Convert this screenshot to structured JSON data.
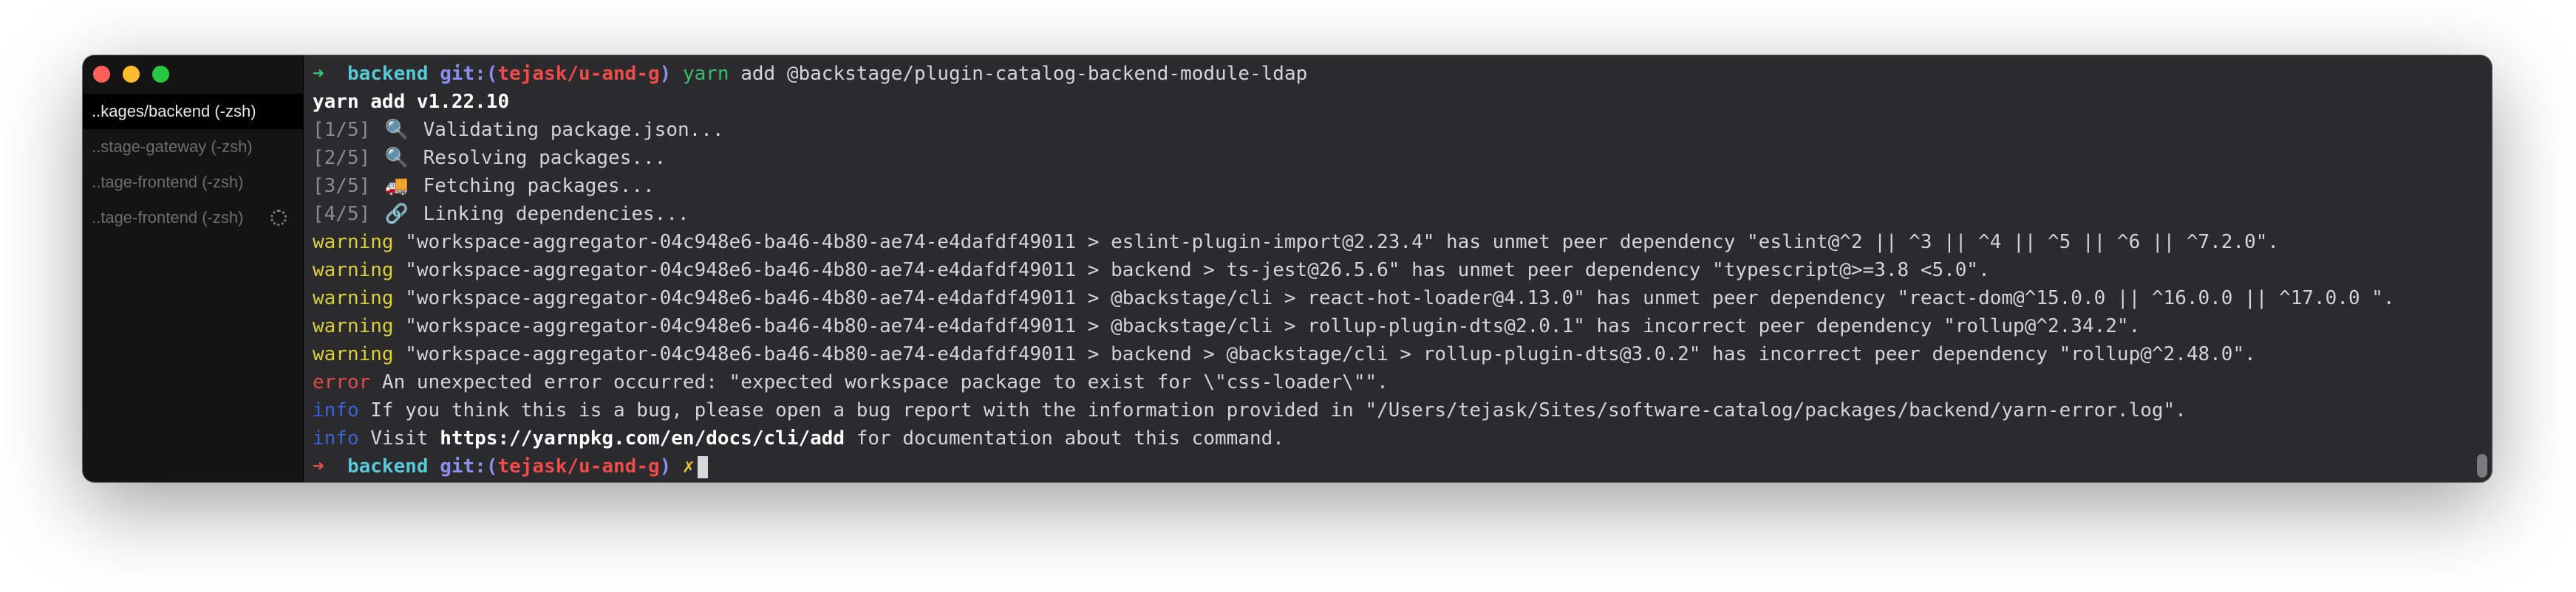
{
  "sidebar": {
    "tabs": [
      {
        "label": "..kages/backend (-zsh)"
      },
      {
        "label": "..stage-gateway (-zsh)"
      },
      {
        "label": "..tage-frontend (-zsh)"
      },
      {
        "label": "..tage-frontend (-zsh)"
      }
    ]
  },
  "terminal": {
    "prompt1": {
      "arrow": "➜",
      "dir": "backend",
      "git_prefix": "git:(",
      "branch": "tejask/u-and-g",
      "git_suffix": ")",
      "cmd": "yarn",
      "args": " add @backstage/plugin-catalog-backend-module-ldap"
    },
    "yarn_version": "yarn add v1.22.10",
    "steps": [
      {
        "step": "[1/5]",
        "icon": "🔍",
        "text": "Validating package.json..."
      },
      {
        "step": "[2/5]",
        "icon": "🔍",
        "text": "Resolving packages..."
      },
      {
        "step": "[3/5]",
        "icon": "🚚",
        "text": "Fetching packages..."
      },
      {
        "step": "[4/5]",
        "icon": "🔗",
        "text": "Linking dependencies..."
      }
    ],
    "warnings": [
      {
        "label": "warning",
        "text": " \"workspace-aggregator-04c948e6-ba46-4b80-ae74-e4dafdf49011 > eslint-plugin-import@2.23.4\" has unmet peer dependency \"eslint@^2 || ^3 || ^4 || ^5 || ^6 || ^7.2.0\"."
      },
      {
        "label": "warning",
        "text": " \"workspace-aggregator-04c948e6-ba46-4b80-ae74-e4dafdf49011 > backend > ts-jest@26.5.6\" has unmet peer dependency \"typescript@>=3.8 <5.0\"."
      },
      {
        "label": "warning",
        "text": " \"workspace-aggregator-04c948e6-ba46-4b80-ae74-e4dafdf49011 > @backstage/cli > react-hot-loader@4.13.0\" has unmet peer dependency \"react-dom@^15.0.0 || ^16.0.0 || ^17.0.0 \"."
      },
      {
        "label": "warning",
        "text": " \"workspace-aggregator-04c948e6-ba46-4b80-ae74-e4dafdf49011 > @backstage/cli > rollup-plugin-dts@2.0.1\" has incorrect peer dependency \"rollup@^2.34.2\"."
      },
      {
        "label": "warning",
        "text": " \"workspace-aggregator-04c948e6-ba46-4b80-ae74-e4dafdf49011 > backend > @backstage/cli > rollup-plugin-dts@3.0.2\" has incorrect peer dependency \"rollup@^2.48.0\"."
      }
    ],
    "error": {
      "label": "error",
      "text": " An unexpected error occurred: \"expected workspace package to exist for \\\"css-loader\\\"\"."
    },
    "info1": {
      "label": "info",
      "text": " If you think this is a bug, please open a bug report with the information provided in \"/Users/tejask/Sites/software-catalog/packages/backend/yarn-error.log\"."
    },
    "info2": {
      "label": "info",
      "pre": " Visit ",
      "url": "https://yarnpkg.com/en/docs/cli/add",
      "post": " for documentation about this command."
    },
    "prompt2": {
      "arrow": "➜",
      "dir": "backend",
      "git_prefix": "git:(",
      "branch": "tejask/u-and-g",
      "git_suffix": ")",
      "dirty": "✗"
    }
  }
}
